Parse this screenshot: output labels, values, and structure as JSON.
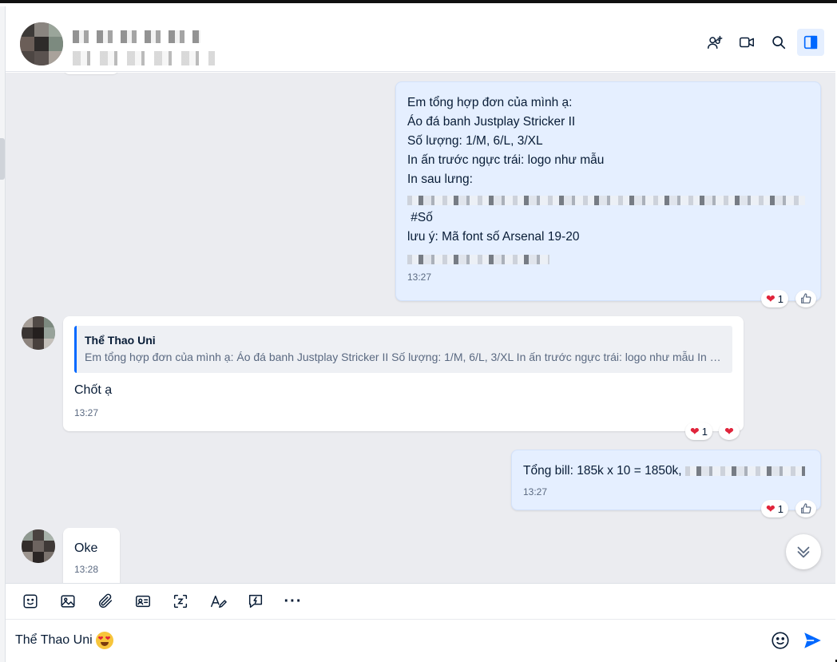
{
  "header": {
    "contact_name": "",
    "contact_status": "",
    "icons": [
      "add-member-icon",
      "video-call-icon",
      "search-icon",
      "sidebar-toggle-icon"
    ],
    "accent_color": "#0068ff"
  },
  "messages": [
    {
      "side": "me",
      "lines": [
        "Em tổng hợp đơn của mình ạ:",
        "Áo đá banh Justplay Stricker II",
        "Số lượng: 1/M, 6/L, 3/XL",
        "In ấn trước ngực trái: logo như mẫu",
        "In sau lưng:",
        " #Số",
        "lưu ý: Mã font số Arsenal 19-20"
      ],
      "time": "13:27",
      "reactions": {
        "heart_count": "1"
      }
    },
    {
      "side": "them",
      "quote": {
        "name": "Thể Thao Uni",
        "text": "Em tổng hợp đơn của mình ạ: Áo đá banh Justplay Stricker II Số lượng: 1/M, 6/L, 3/XL In ấn trước ngực trái: logo như mẫu In s..."
      },
      "text": "Chốt ạ",
      "time": "13:27",
      "reactions": {
        "heart_count": "1"
      }
    },
    {
      "side": "me",
      "text": "Tổng bill: 185k x 10 = 1850k, ",
      "time": "13:27",
      "reactions": {
        "heart_count": "1"
      }
    },
    {
      "side": "them",
      "text": "Oke",
      "time": "13:28"
    }
  ],
  "toolbar": {
    "icons": [
      "sticker-icon",
      "image-icon",
      "attachment-icon",
      "contact-card-icon",
      "screenshot-icon",
      "text-format-icon",
      "quick-message-icon",
      "more-icon"
    ],
    "more_label": "···"
  },
  "composer": {
    "value": "Thể Thao Uni",
    "icons": [
      "emoji-icon",
      "send-icon"
    ]
  }
}
